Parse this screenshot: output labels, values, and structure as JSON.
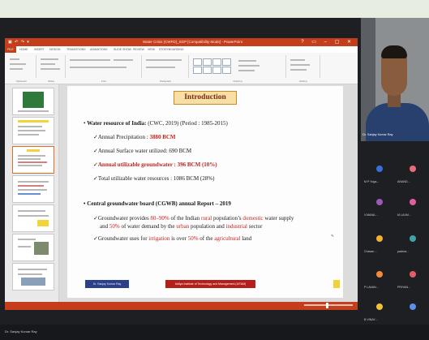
{
  "window": {
    "title": "Water Crisis (CWFD)_SGP [Compatibility Mode] - PowerPoint",
    "file_tab": "FILE",
    "tabs": [
      "HOME",
      "INSERT",
      "DESIGN",
      "TRANSITIONS",
      "ANIMATIONS",
      "SLIDE SHOW",
      "REVIEW",
      "VIEW",
      "STORYBOARDING"
    ],
    "ribbon_groups": [
      "Clipboard",
      "Slides",
      "Font",
      "Paragraph",
      "Drawing",
      "Editing"
    ]
  },
  "slide": {
    "title": "Introduction",
    "section1": {
      "heading": "Water resource of India:",
      "heading_rest": " (CWC, 2019) (Period : 1985-2015)",
      "items": [
        {
          "label": "Annual Precipitation : ",
          "value": "3880 BCM"
        },
        {
          "label": "Annual Surface water utilized: 690 BCM"
        },
        {
          "label": "Annual utilizable  groundwater : 396 BCM (10%)"
        },
        {
          "label": "Total utilizable water resources : 1086 BCM (28%)"
        }
      ]
    },
    "section2": {
      "heading": "Central groundwater board (CGWB) annual Report – 2019",
      "p1": {
        "a": "Groundwater provides ",
        "b": "80–90%",
        "c": " of the Indian ",
        "d": "rural",
        "e": " population’s ",
        "f": "domestic",
        "g": " water supply",
        "h": "and ",
        "i": "50%",
        "j": " of water demand by the ",
        "k": "urban",
        "l": " population and ",
        "m": "industrial",
        "n": " sector"
      },
      "p2": {
        "a": "Groundwater uses for ",
        "b": "irrigation",
        "c": " is over ",
        "d": "50%",
        "e": " of the ",
        "f": "agricultural",
        "g": " land"
      }
    },
    "footer_left": "Dr. Sanjay Kumar Ray",
    "footer_center": "Aditya Institute of Technology and Management (AITAM)"
  },
  "presenter": {
    "name": "Dr. Sanjay Kumar Ray"
  },
  "participants": [
    {
      "name": "M P Yoga...",
      "color": "#3b6fd6"
    },
    {
      "name": "ANAND...",
      "color": "#e96b7a"
    },
    {
      "name": "V.MANA...",
      "color": "#9b59b6"
    },
    {
      "name": "M LAXM...",
      "color": "#e05f9a"
    },
    {
      "name": "Chavan ...",
      "color": "#f2b233"
    },
    {
      "name": "padma...",
      "color": "#3fa3a8"
    },
    {
      "name": "P LAVAN...",
      "color": "#f58a3c"
    },
    {
      "name": "PRIYAN...",
      "color": "#e8596a"
    },
    {
      "name": "B VINAY...",
      "color": "#f0c23c"
    },
    {
      "name": "",
      "color": "#5b8fe8"
    }
  ],
  "bottom_bar": {
    "name": "Dr. Sanjay Kumar Ray"
  },
  "colors": {
    "ppt_accent": "#c43e1c",
    "title_box": "#f7dfa6",
    "highlight_red": "#c2241c"
  }
}
